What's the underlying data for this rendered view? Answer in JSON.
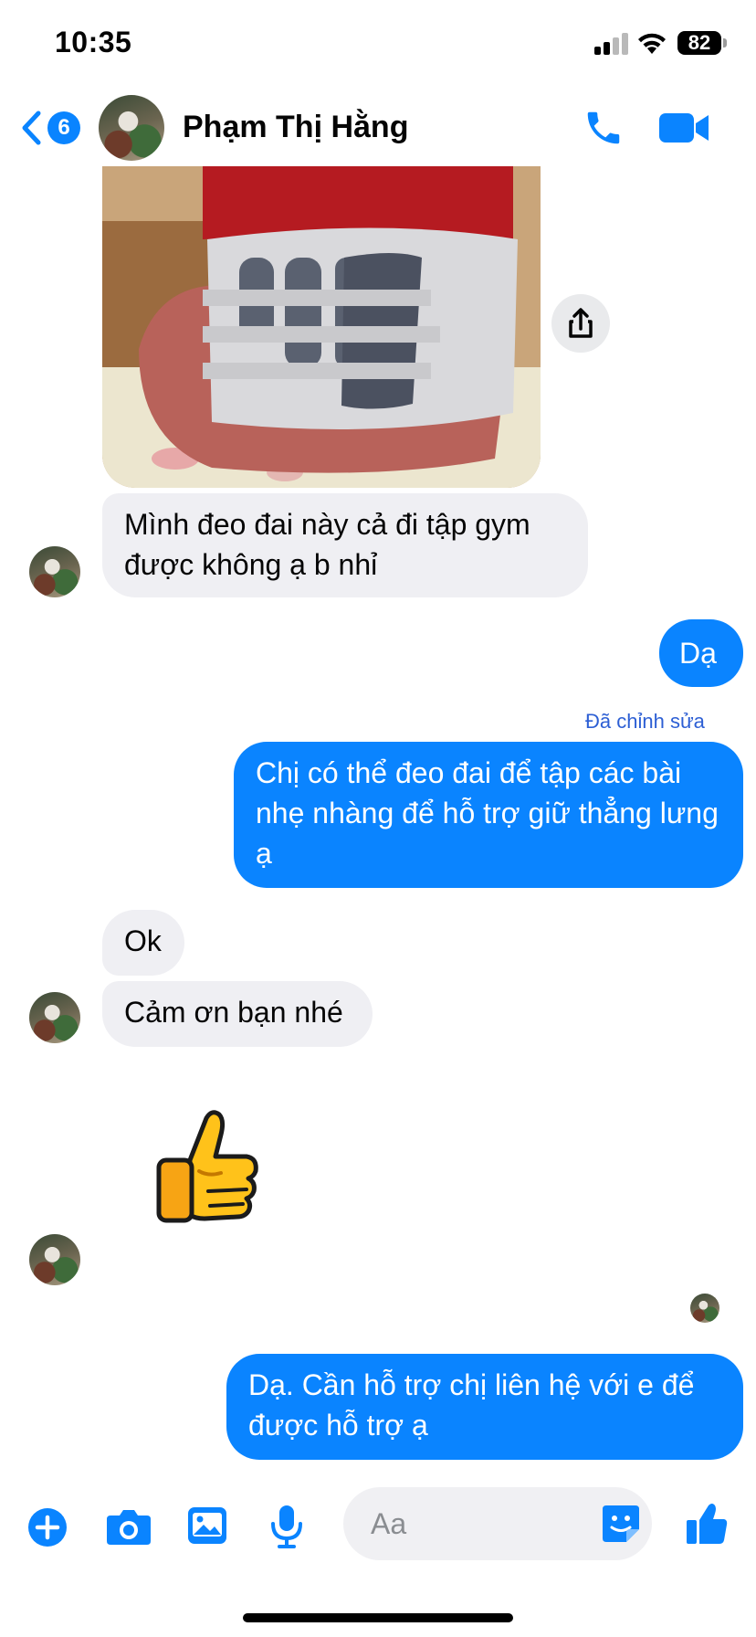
{
  "status_bar": {
    "time": "10:35",
    "battery": "82"
  },
  "header": {
    "back_count": "6",
    "contact_name": "Phạm Thị Hằng",
    "call_icon": "phone-icon",
    "video_icon": "video-camera-icon"
  },
  "messages": [
    {
      "id": "photo",
      "sender": "contact",
      "type": "image",
      "description_icon": "photo-back-brace"
    },
    {
      "id": "b1",
      "sender": "contact",
      "text": "Mình đeo đai này cả đi tập gym được không ạ b nhỉ"
    },
    {
      "id": "b2",
      "sender": "me",
      "text": "Dạ"
    },
    {
      "id": "b3",
      "sender": "me",
      "edited_label": "Đã chỉnh sửa",
      "text": "Chị có thể đeo đai để tập các bài nhẹ nhàng để hỗ trợ giữ thẳng lưng ạ"
    },
    {
      "id": "b4",
      "sender": "contact",
      "text": "Ok"
    },
    {
      "id": "b5",
      "sender": "contact",
      "text": "Cảm ơn bạn nhé"
    },
    {
      "id": "sticker",
      "sender": "contact",
      "type": "sticker",
      "icon": "thumbs-up-icon"
    },
    {
      "id": "b6",
      "sender": "me",
      "text": "Dạ. Cần hỗ trợ chị liên hệ với e để được hỗ trợ ạ"
    }
  ],
  "composer": {
    "placeholder": "Aa"
  },
  "colors": {
    "accent": "#0a84ff",
    "incoming_bubble": "#efeff3",
    "edited_label": "#2d5fd4"
  }
}
